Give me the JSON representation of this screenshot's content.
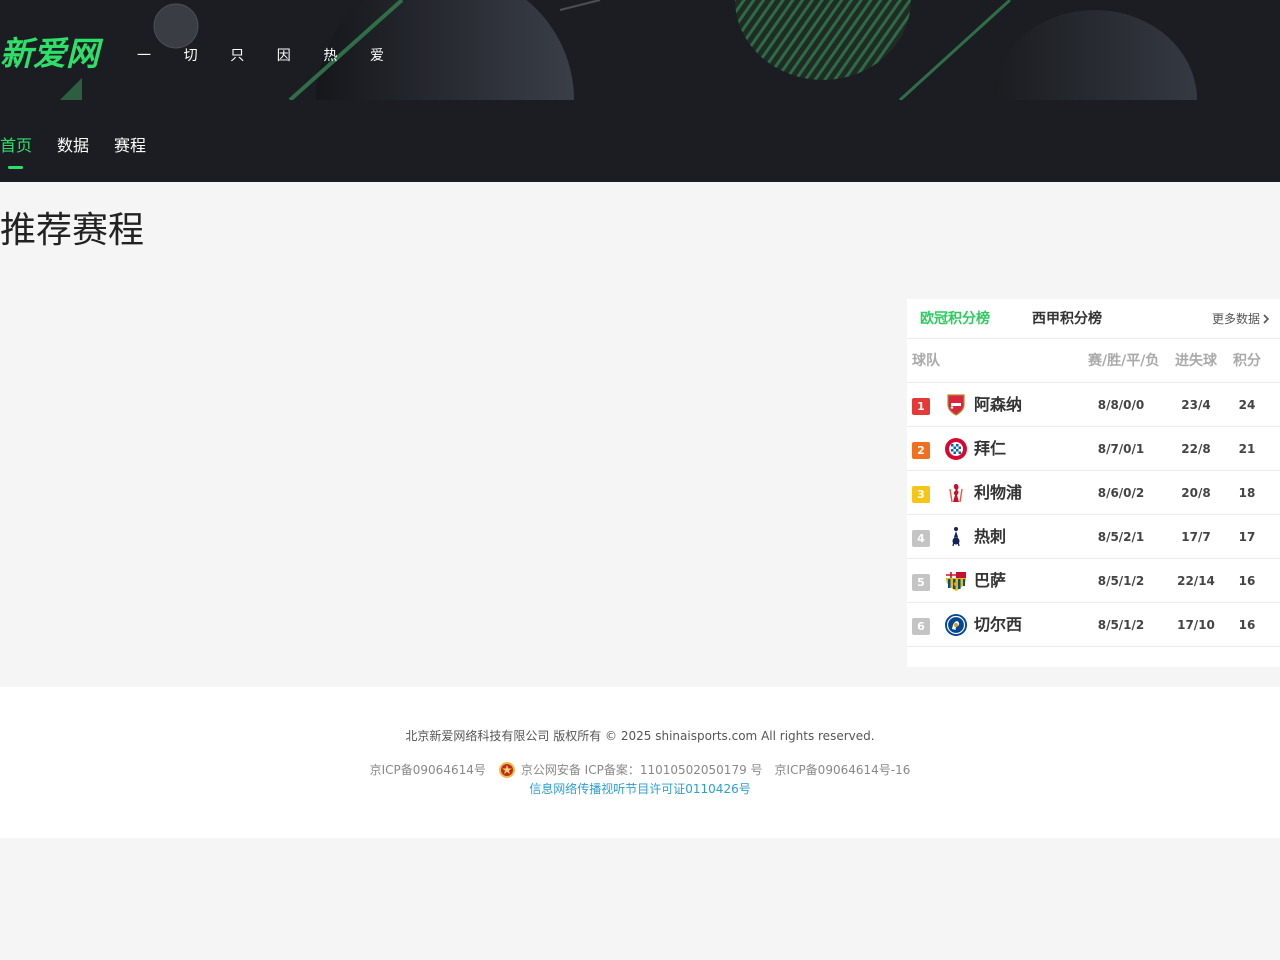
{
  "header": {
    "logo_text": "新爱网",
    "slogan": [
      "一",
      "切",
      "只",
      "因",
      "热",
      "爱"
    ],
    "nav": [
      {
        "label": "首页",
        "active": true
      },
      {
        "label": "数据",
        "active": false
      },
      {
        "label": "赛程",
        "active": false
      }
    ],
    "accent_color": "#2ee06a",
    "background_color": "#1b1d22"
  },
  "main": {
    "section_title": "推荐赛程"
  },
  "standings": {
    "tabs": [
      {
        "label": "欧冠积分榜",
        "active": true
      },
      {
        "label": "西甲积分榜",
        "active": false
      }
    ],
    "more_label": "更多数据",
    "columns": {
      "team": "球队",
      "record": "赛/胜/平/负",
      "goals": "进失球",
      "points": "积分"
    },
    "rows": [
      {
        "rank": "1",
        "rank_color": "#e53935",
        "crest": "arsenal-crest-icon",
        "team": "阿森纳",
        "record": "8/8/0/0",
        "goals": "23/4",
        "points": "24"
      },
      {
        "rank": "2",
        "rank_color": "#f07020",
        "crest": "bayern-crest-icon",
        "team": "拜仁",
        "record": "8/7/0/1",
        "goals": "22/8",
        "points": "21"
      },
      {
        "rank": "3",
        "rank_color": "#f5c518",
        "crest": "liverpool-crest-icon",
        "team": "利物浦",
        "record": "8/6/0/2",
        "goals": "20/8",
        "points": "18"
      },
      {
        "rank": "4",
        "rank_color": "#c4c4c4",
        "crest": "tottenham-crest-icon",
        "team": "热刺",
        "record": "8/5/2/1",
        "goals": "17/7",
        "points": "17"
      },
      {
        "rank": "5",
        "rank_color": "#c4c4c4",
        "crest": "barcelona-crest-icon",
        "team": "巴萨",
        "record": "8/5/1/2",
        "goals": "22/14",
        "points": "16"
      },
      {
        "rank": "6",
        "rank_color": "#c4c4c4",
        "crest": "chelsea-crest-icon",
        "team": "切尔西",
        "record": "8/5/1/2",
        "goals": "17/10",
        "points": "16"
      }
    ]
  },
  "footer": {
    "copyright": "北京新爱网络科技有限公司 版权所有 © 2025 shinaisports.com All rights reserved.",
    "icp1": "京ICP备09064614号",
    "police_record": "京公网安备 ICP备案：11010502050179 号",
    "icp2": "京ICP备09064614号-16",
    "license": "信息网络传播视听节目许可证0110426号",
    "license_color": "#2a9fd6"
  }
}
